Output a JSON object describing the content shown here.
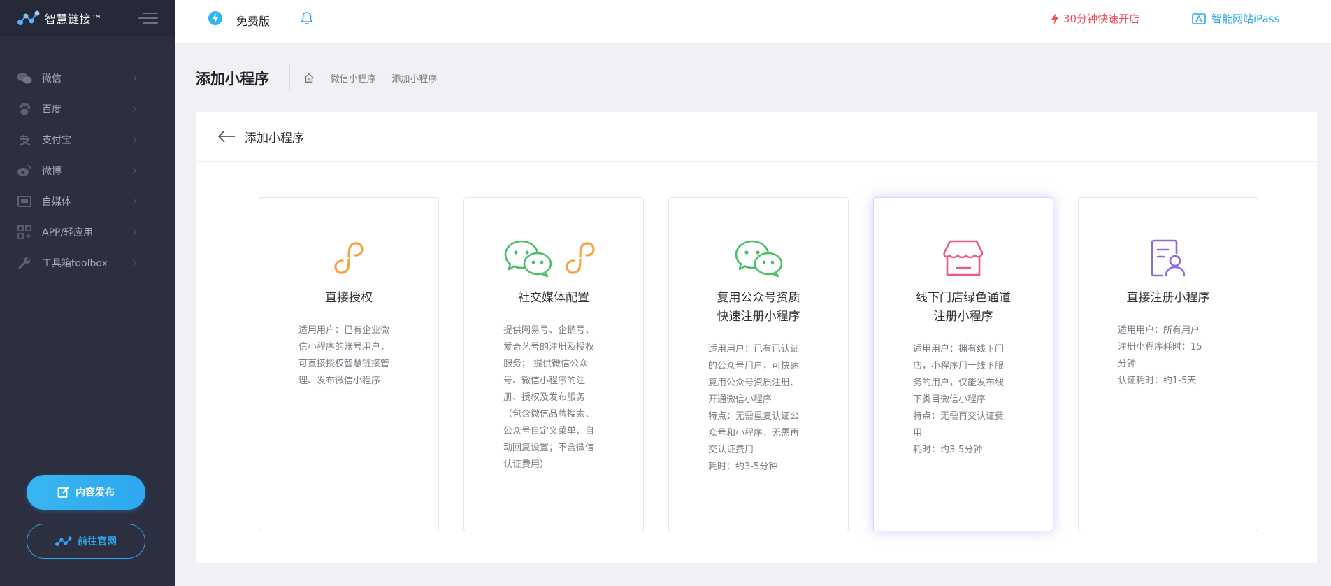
{
  "app": {
    "name": "智慧链接™",
    "colors": {
      "sidebar": "#2b2f3f",
      "accent": "#2ea7ef",
      "danger": "#f0505a"
    }
  },
  "sidebar": {
    "items": [
      {
        "label": "微信",
        "icon": "wechat-icon"
      },
      {
        "label": "百度",
        "icon": "paw-icon"
      },
      {
        "label": "支付宝",
        "icon": "alipay-icon"
      },
      {
        "label": "微博",
        "icon": "weibo-icon"
      },
      {
        "label": "自媒体",
        "icon": "media-icon"
      },
      {
        "label": "APP/轻应用",
        "icon": "apps-grid-icon"
      },
      {
        "label": "工具箱toolbox",
        "icon": "wrench-icon"
      }
    ],
    "publish_button": "内容发布",
    "site_button": "前往官网"
  },
  "topbar": {
    "plan": "免费版",
    "fast_open": "30分钟快速开店",
    "ipass": "智能网站iPass"
  },
  "header": {
    "title": "添加小程序",
    "breadcrumb": [
      "微信小程序",
      "添加小程序"
    ]
  },
  "panel": {
    "title": "添加小程序",
    "cards": [
      {
        "title_lines": [
          "直接授权"
        ],
        "desc": [
          "适用用户：已有企业微",
          "信小程序的账号用户，",
          "可直接授权智慧链接管",
          "理、发布微信小程序"
        ]
      },
      {
        "title_lines": [
          "社交媒体配置"
        ],
        "desc": [
          "提供网易号、企鹅号、",
          "爱奇艺号的注册及授权",
          "服务； 提供微信公众",
          "号、微信小程序的注",
          "册、授权及发布服务",
          "（包含微信品牌搜索、",
          "公众号自定义菜单、自",
          "动回复设置；不含微信",
          "认证费用）"
        ]
      },
      {
        "title_lines": [
          "复用公众号资质",
          "快速注册小程序"
        ],
        "desc": [
          "适用用户：已有已认证",
          "的公众号用户，可快速",
          "复用公众号资质注册、",
          "开通微信小程序",
          "特点：无需重复认证公",
          "众号和小程序，无需再",
          "交认证费用",
          "耗时：约3-5分钟"
        ]
      },
      {
        "title_lines": [
          "线下门店绿色通道",
          "注册小程序"
        ],
        "desc": [
          "适用用户：拥有线下门",
          "店，小程序用于线下服",
          "务的用户，仅能发布线",
          "下类目微信小程序",
          "特点：无需再交认证费",
          "用",
          "耗时：约3-5分钟"
        ]
      },
      {
        "title_lines": [
          "直接注册小程序"
        ],
        "desc": [
          "适用用户：所有用户",
          "注册小程序耗时：15",
          "分钟",
          "认证耗时：约1-5天"
        ]
      }
    ]
  }
}
